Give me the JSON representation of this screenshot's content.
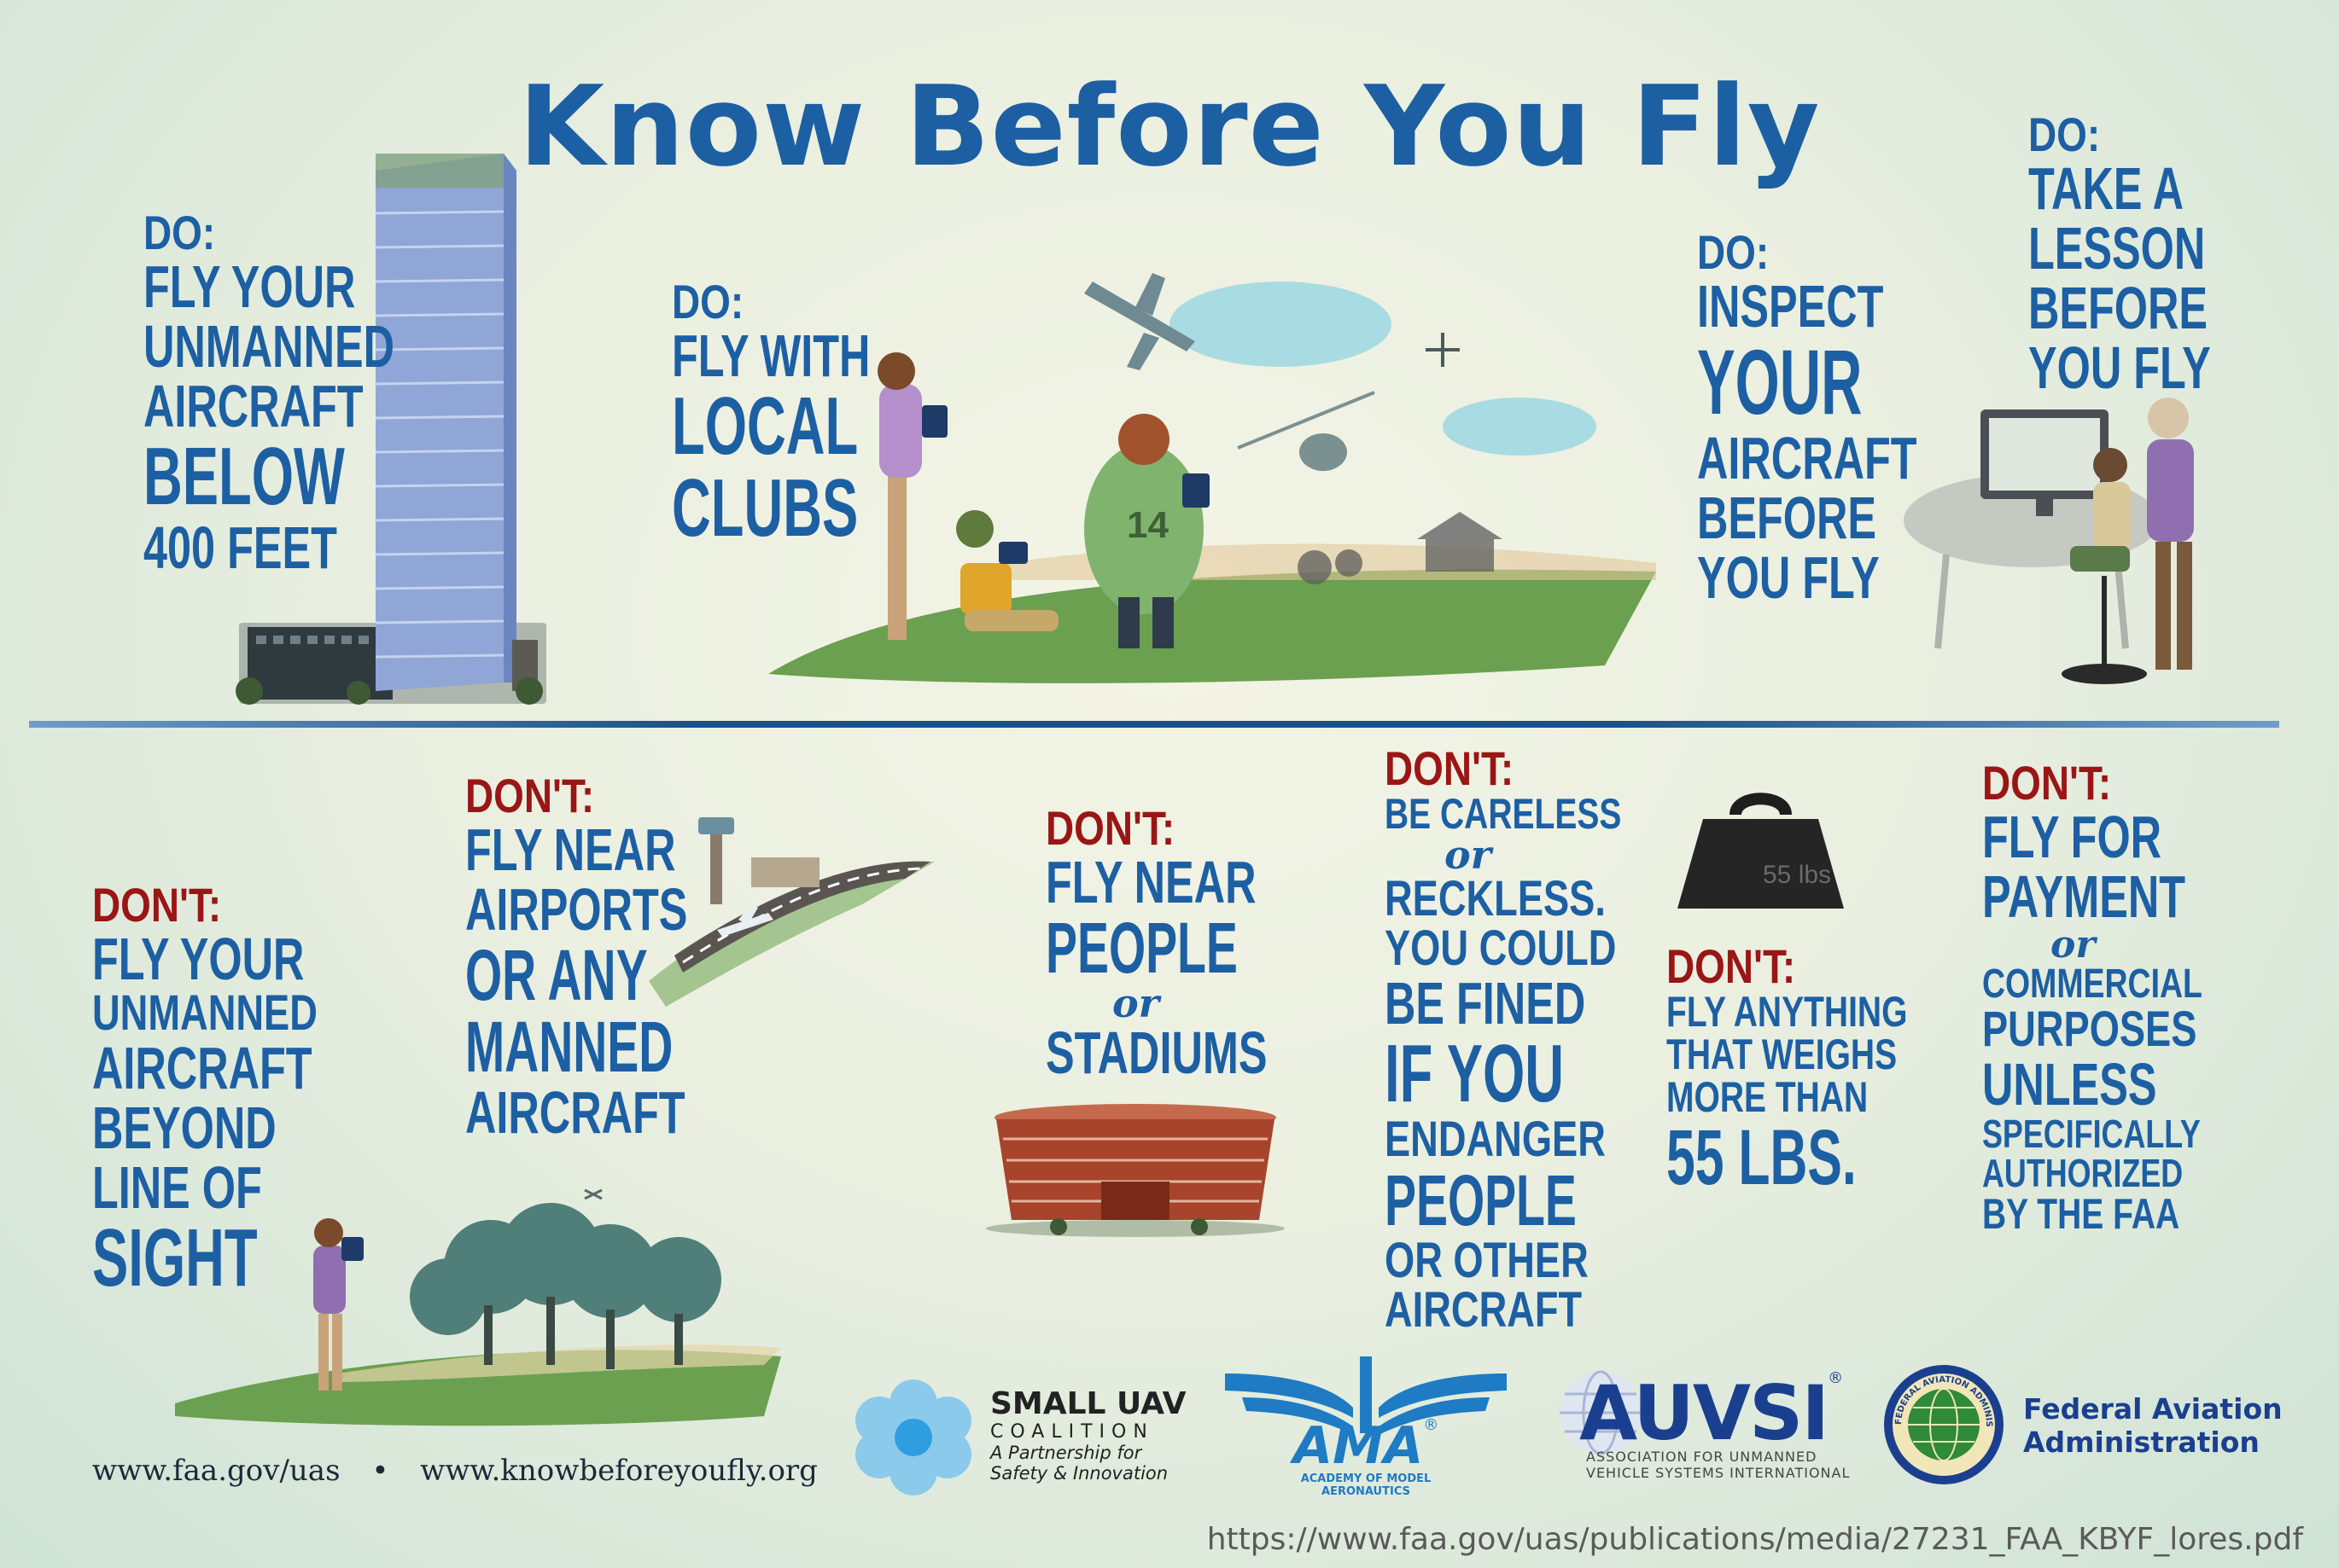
{
  "title": "Know Before You Fly",
  "do_blocks": [
    {
      "label": "DO:",
      "lines": [
        "FLY YOUR",
        "UNMANNED",
        "AIRCRAFT",
        "BELOW",
        "400 FEET"
      ]
    },
    {
      "label": "DO:",
      "lines": [
        "FLY WITH",
        "LOCAL",
        "CLUBS"
      ]
    },
    {
      "label": "DO:",
      "lines": [
        "INSPECT",
        "YOUR",
        "AIRCRAFT",
        "BEFORE",
        "YOU FLY"
      ]
    },
    {
      "label": "DO:",
      "lines": [
        "TAKE A",
        "LESSON",
        "BEFORE",
        "YOU FLY"
      ]
    }
  ],
  "dont_blocks": [
    {
      "label": "DON'T:",
      "lines": [
        "FLY YOUR",
        "UNMANNED",
        "AIRCRAFT",
        "BEYOND",
        "LINE OF",
        "SIGHT"
      ]
    },
    {
      "label": "DON'T:",
      "lines": [
        "FLY NEAR",
        "AIRPORTS",
        "OR ANY",
        "MANNED",
        "AIRCRAFT"
      ]
    },
    {
      "label": "DON'T:",
      "lines": [
        "FLY NEAR",
        "PEOPLE",
        "or",
        "STADIUMS"
      ]
    },
    {
      "label": "DON'T:",
      "lines": [
        "BE CARELESS",
        "or",
        "RECKLESS.",
        "YOU COULD",
        "BE FINED",
        "IF YOU",
        "ENDANGER",
        "PEOPLE",
        "OR OTHER",
        "AIRCRAFT"
      ]
    },
    {
      "label": "DON'T:",
      "lines": [
        "FLY ANYTHING",
        "THAT WEIGHS",
        "MORE THAN",
        "55 LBS."
      ]
    },
    {
      "label": "DON'T:",
      "lines": [
        "FLY FOR",
        "PAYMENT",
        "or",
        "COMMERCIAL",
        "PURPOSES",
        "UNLESS",
        "SPECIFICALLY",
        "AUTHORIZED",
        "BY THE FAA"
      ]
    }
  ],
  "illustrations": {
    "jersey_number": "14",
    "weight_label": "55 lbs"
  },
  "footer": {
    "url_1": "www.faa.gov/uas",
    "separator": "•",
    "url_2": "www.knowbeforeyoufly.org",
    "source_url": "https://www.faa.gov/uas/publications/media/27231_FAA_KBYF_lores.pdf"
  },
  "logos": {
    "small_uav": {
      "line1": "SMALL UAV",
      "line2": "COALITION",
      "line3": "A Partnership for",
      "line4": "Safety & Innovation"
    },
    "ama": {
      "name": "AMA",
      "reg": "®",
      "sub": "ACADEMY OF MODEL AERONAUTICS"
    },
    "auvsi": {
      "name": "AUVSI",
      "reg": "®",
      "sub1": "ASSOCIATION FOR UNMANNED",
      "sub2": "VEHICLE SYSTEMS INTERNATIONAL"
    },
    "faa": {
      "line1": "Federal Aviation",
      "line2": "Administration",
      "seal_text": "FEDERAL AVIATION ADMINISTRATION"
    }
  },
  "colors": {
    "title": "#1d5fa3",
    "do": "#1d5fa3",
    "dont": "#9a1616",
    "divider": "#1b4f8a"
  }
}
